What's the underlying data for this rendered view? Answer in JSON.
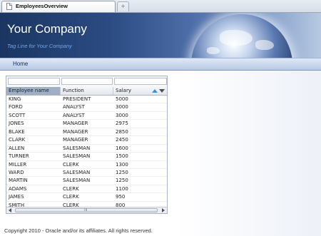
{
  "browser": {
    "tab_title": "EmployeesOverview",
    "new_tab_symbol": "+"
  },
  "header": {
    "company": "Your Company",
    "tagline": "Tag Line for Your Company"
  },
  "nav": {
    "home": "Home"
  },
  "table": {
    "columns": [
      "Employee name",
      "Function",
      "Salary"
    ],
    "sorted_column": "Employee name",
    "rows": [
      [
        "KING",
        "PRESIDENT",
        "5000"
      ],
      [
        "FORD",
        "ANALYST",
        "3000"
      ],
      [
        "SCOTT",
        "ANALYST",
        "3000"
      ],
      [
        "JONES",
        "MANAGER",
        "2975"
      ],
      [
        "BLAKE",
        "MANAGER",
        "2850"
      ],
      [
        "CLARK",
        "MANAGER",
        "2450"
      ],
      [
        "ALLEN",
        "SALESMAN",
        "1600"
      ],
      [
        "TURNER",
        "SALESMAN",
        "1500"
      ],
      [
        "MILLER",
        "CLERK",
        "1300"
      ],
      [
        "WARD",
        "SALESMAN",
        "1250"
      ],
      [
        "MARTIN",
        "SALESMAN",
        "1250"
      ],
      [
        "ADAMS",
        "CLERK",
        "1100"
      ],
      [
        "JAMES",
        "CLERK",
        "950"
      ],
      [
        "SMITH",
        "CLERK",
        "800"
      ]
    ],
    "scroll_grip": "III"
  },
  "footer": {
    "copyright": "Copyright 2010 - Oracle and/or its affiliates. All rights reserved."
  },
  "colors": {
    "header_dark": "#1a3561",
    "tagline": "#6fa6f0",
    "nav_text": "#10306a",
    "sorted_header": "#9fb0c6",
    "sort_asc_arrow": "#3d8fe0"
  }
}
